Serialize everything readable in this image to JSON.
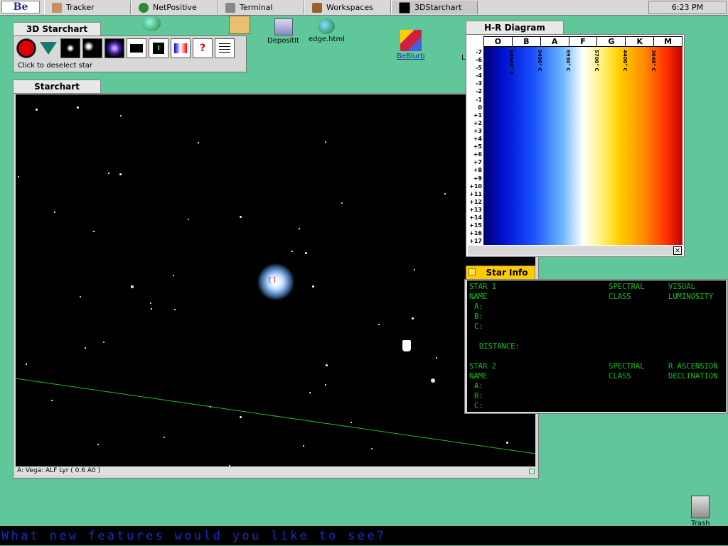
{
  "deskbar": {
    "be_menu": "Be",
    "tasks": [
      "Tracker",
      "NetPositive",
      "Terminal",
      "Workspaces",
      "3DStarchart"
    ],
    "clock": "6:23 PM"
  },
  "desktop": {
    "icons": [
      "DepositIt",
      "edge.html",
      "BeBlurb",
      "Trash"
    ],
    "partial_label": "L"
  },
  "toolbar_window": {
    "title": "3D Starchart",
    "status": "Click to deselect star"
  },
  "starchart_window": {
    "title": "Starchart",
    "status": "A: Vega: ALF Lyr ( 0.6 A0 )",
    "marker": "[ ]"
  },
  "hr_window": {
    "title": "H-R Diagram",
    "classes": [
      "O",
      "B",
      "A",
      "F",
      "G",
      "K",
      "M"
    ],
    "magnitudes": [
      "-7",
      "-6",
      "-5",
      "-4",
      "-3",
      "-2",
      "-1",
      "0",
      "+1",
      "+2",
      "+3",
      "+4",
      "+5",
      "+6",
      "+7",
      "+8",
      "+9",
      "+10",
      "+11",
      "+12",
      "+13",
      "+14",
      "+15",
      "+16",
      "+17"
    ],
    "temps": [
      "10500° C",
      "9450° C",
      "6930° C",
      "5700° C",
      "4400° C",
      "3048° C"
    ],
    "close": "×"
  },
  "star_info": {
    "title": "Star Info",
    "star1": {
      "label1": "STAR 1",
      "label2": "NAME",
      "col1a": "SPECTRAL",
      "col1b": "CLASS",
      "col2a": "VISUAL",
      "col2b": "LUMINOSITY",
      "a": "A:",
      "b": "B:",
      "c": "C:",
      "distance": "DISTANCE:"
    },
    "star2": {
      "label1": "STAR 2",
      "label2": "NAME",
      "col1a": "SPECTRAL",
      "col1b": "CLASS",
      "col2a": "R ASCENSION",
      "col2b": "DECLINATION",
      "a": "A:",
      "b": "B:",
      "c": "C:"
    }
  },
  "prompt_bar": "What new features would you like to see?",
  "colors": {
    "desktop": "#5fc79a",
    "info_text": "#16c016",
    "prompt": "#1a2ac0"
  }
}
